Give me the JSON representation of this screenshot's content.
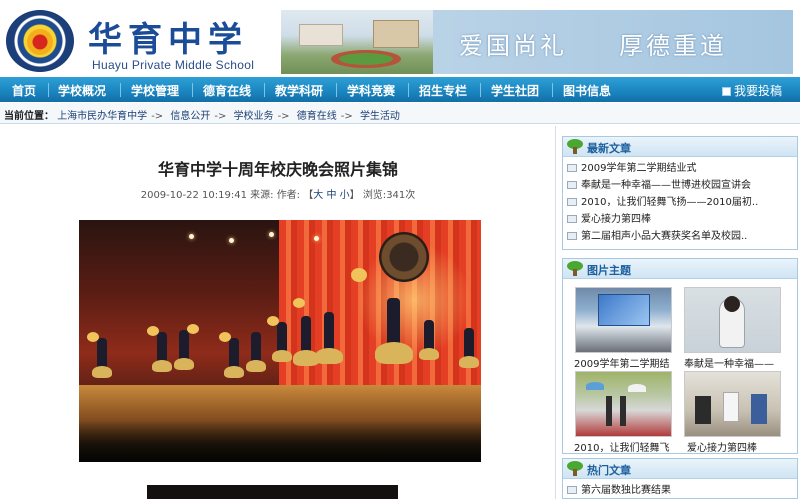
{
  "header": {
    "school_name_cn": "华育中学",
    "school_name_en": "Huayu Private Middle School",
    "slogan_left": "爱国尚礼",
    "slogan_right": "厚德重道"
  },
  "nav": {
    "items": [
      "首页",
      "学校概况",
      "学校管理",
      "德育在线",
      "教学科研",
      "学科竞赛",
      "招生专栏",
      "学生社团",
      "图书信息"
    ],
    "post_label": "我要投稿"
  },
  "breadcrumb": {
    "label": "当前位置：",
    "items": [
      "上海市民办华育中学",
      "信息公开",
      "学校业务",
      "德育在线",
      "学生活动"
    ],
    "separator": "->"
  },
  "article": {
    "title": "华育中学十周年校庆晚会照片集锦",
    "datetime": "2009-10-22 10:19:41",
    "source_label": "来源:",
    "author_label": "作者:",
    "size_open": "【",
    "size_large": "大",
    "size_medium": "中",
    "size_small": "小",
    "size_close": "】",
    "views_label": "浏览:",
    "views_value": "341",
    "views_unit": "次"
  },
  "sidebar": {
    "latest": {
      "title": "最新文章",
      "items": [
        "2009学年第二学期结业式",
        "奉献是一种幸福——世博进校园宣讲会",
        "2010，让我们轻舞飞扬——2010届初..",
        "爱心接力第四棒",
        "第二届相声小品大赛获奖名单及校园.."
      ]
    },
    "photos": {
      "title": "图片主题",
      "captions": [
        "2009学年第二学期结",
        "奉献是一种幸福——",
        "2010，让我们轻舞飞",
        "爱心接力第四棒"
      ]
    },
    "hot": {
      "title": "热门文章",
      "items": [
        "第六届数独比赛结果"
      ]
    }
  },
  "colors": {
    "nav_blue": "#1a84bf",
    "title_blue": "#1b4c97",
    "sidebar_head": "#1d5f9e"
  }
}
